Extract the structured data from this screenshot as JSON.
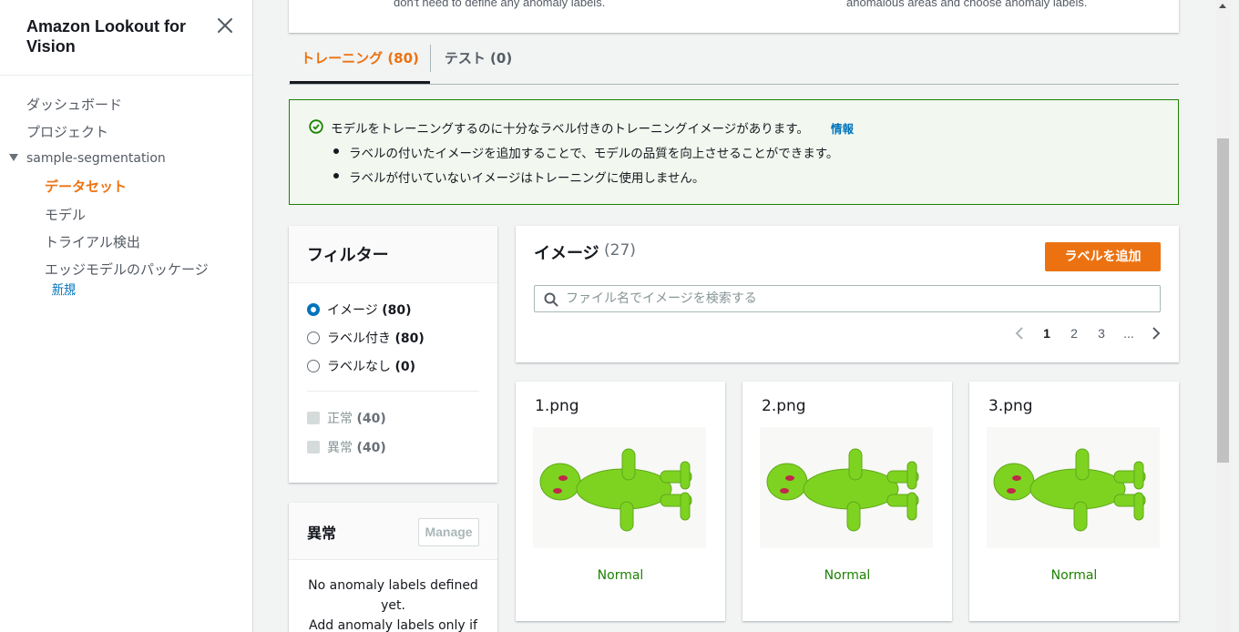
{
  "sidebar": {
    "title": "Amazon Lookout for Vision",
    "nav": {
      "dashboard": "ダッシュボード",
      "projects": "プロジェクト",
      "project_name": "sample-segmentation",
      "dataset": "データセット",
      "models": "モデル",
      "trial_detection": "トライアル検出",
      "edge_packages": "エッジモデルのパッケージ",
      "new_badge": "新規"
    }
  },
  "top_card": {
    "left_text": "don't need to define any anomaly labels.",
    "right_text": "anomalous areas and choose anomaly labels."
  },
  "tabs": [
    {
      "label": "トレーニング (80)",
      "active": true
    },
    {
      "label": "テスト (0)",
      "active": false
    }
  ],
  "flash": {
    "title": "モデルをトレーニングするのに十分なラベル付きのトレーニングイメージがあります。",
    "info_link": "情報",
    "bullets": [
      "ラベルの付いたイメージを追加することで、モデルの品質を向上させることができます。",
      "ラベルが付いていないイメージはトレーニングに使用しません。"
    ]
  },
  "filter": {
    "title": "フィルター",
    "radios": [
      {
        "label": "イメージ",
        "count": "(80)",
        "checked": true
      },
      {
        "label": "ラベル付き",
        "count": "(80)",
        "checked": false
      },
      {
        "label": "ラベルなし",
        "count": "(0)",
        "checked": false
      }
    ],
    "checkboxes": [
      {
        "label": "正常",
        "count": "(40)"
      },
      {
        "label": "異常",
        "count": "(40)"
      }
    ]
  },
  "anomaly": {
    "title": "異常",
    "manage_label": "Manage",
    "text_line1": "No anomaly labels defined yet.",
    "text_line2": "Add anomaly labels only if"
  },
  "images": {
    "title": "イメージ",
    "count": "(27)",
    "add_label_button": "ラベルを追加",
    "search_placeholder": "ファイル名でイメージを検索する",
    "pagination": [
      "1",
      "2",
      "3",
      "..."
    ]
  },
  "cards": [
    {
      "name": "1.png",
      "status": "Normal"
    },
    {
      "name": "2.png",
      "status": "Normal"
    },
    {
      "name": "3.png",
      "status": "Normal"
    }
  ],
  "colors": {
    "accent": "#ec7211",
    "link": "#0073bb",
    "success": "#1d8102",
    "figure": "#7ed321"
  }
}
